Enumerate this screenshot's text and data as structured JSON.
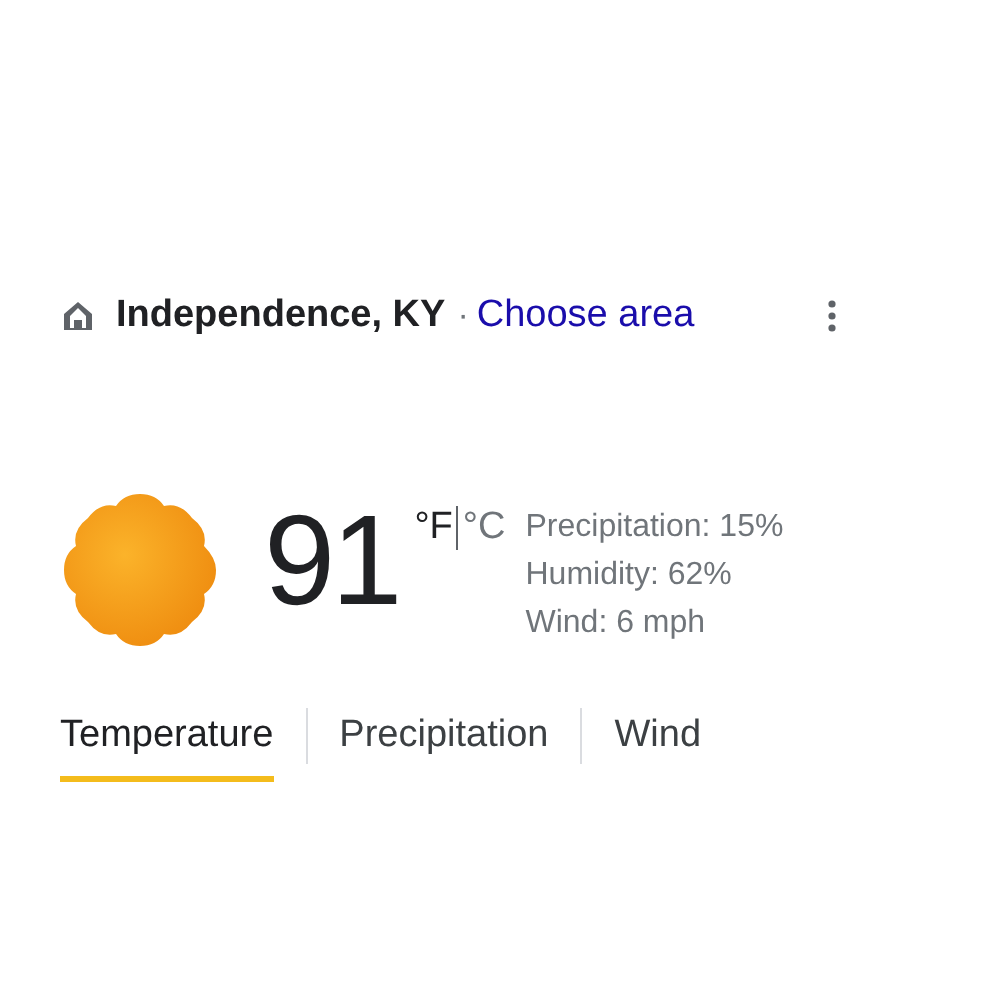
{
  "location": {
    "name": "Independence, KY",
    "separator": "·",
    "link": "Choose area"
  },
  "current": {
    "temperature": "91",
    "units": [
      {
        "label": "°F",
        "selected": true
      },
      {
        "label": "°C",
        "selected": false
      }
    ],
    "details": [
      "Precipitation: 15%",
      "Humidity: 62%",
      "Wind: 6 mph"
    ]
  },
  "tabs": [
    {
      "label": "Temperature",
      "selected": true
    },
    {
      "label": "Precipitation",
      "selected": false
    },
    {
      "label": "Wind",
      "selected": false
    }
  ]
}
